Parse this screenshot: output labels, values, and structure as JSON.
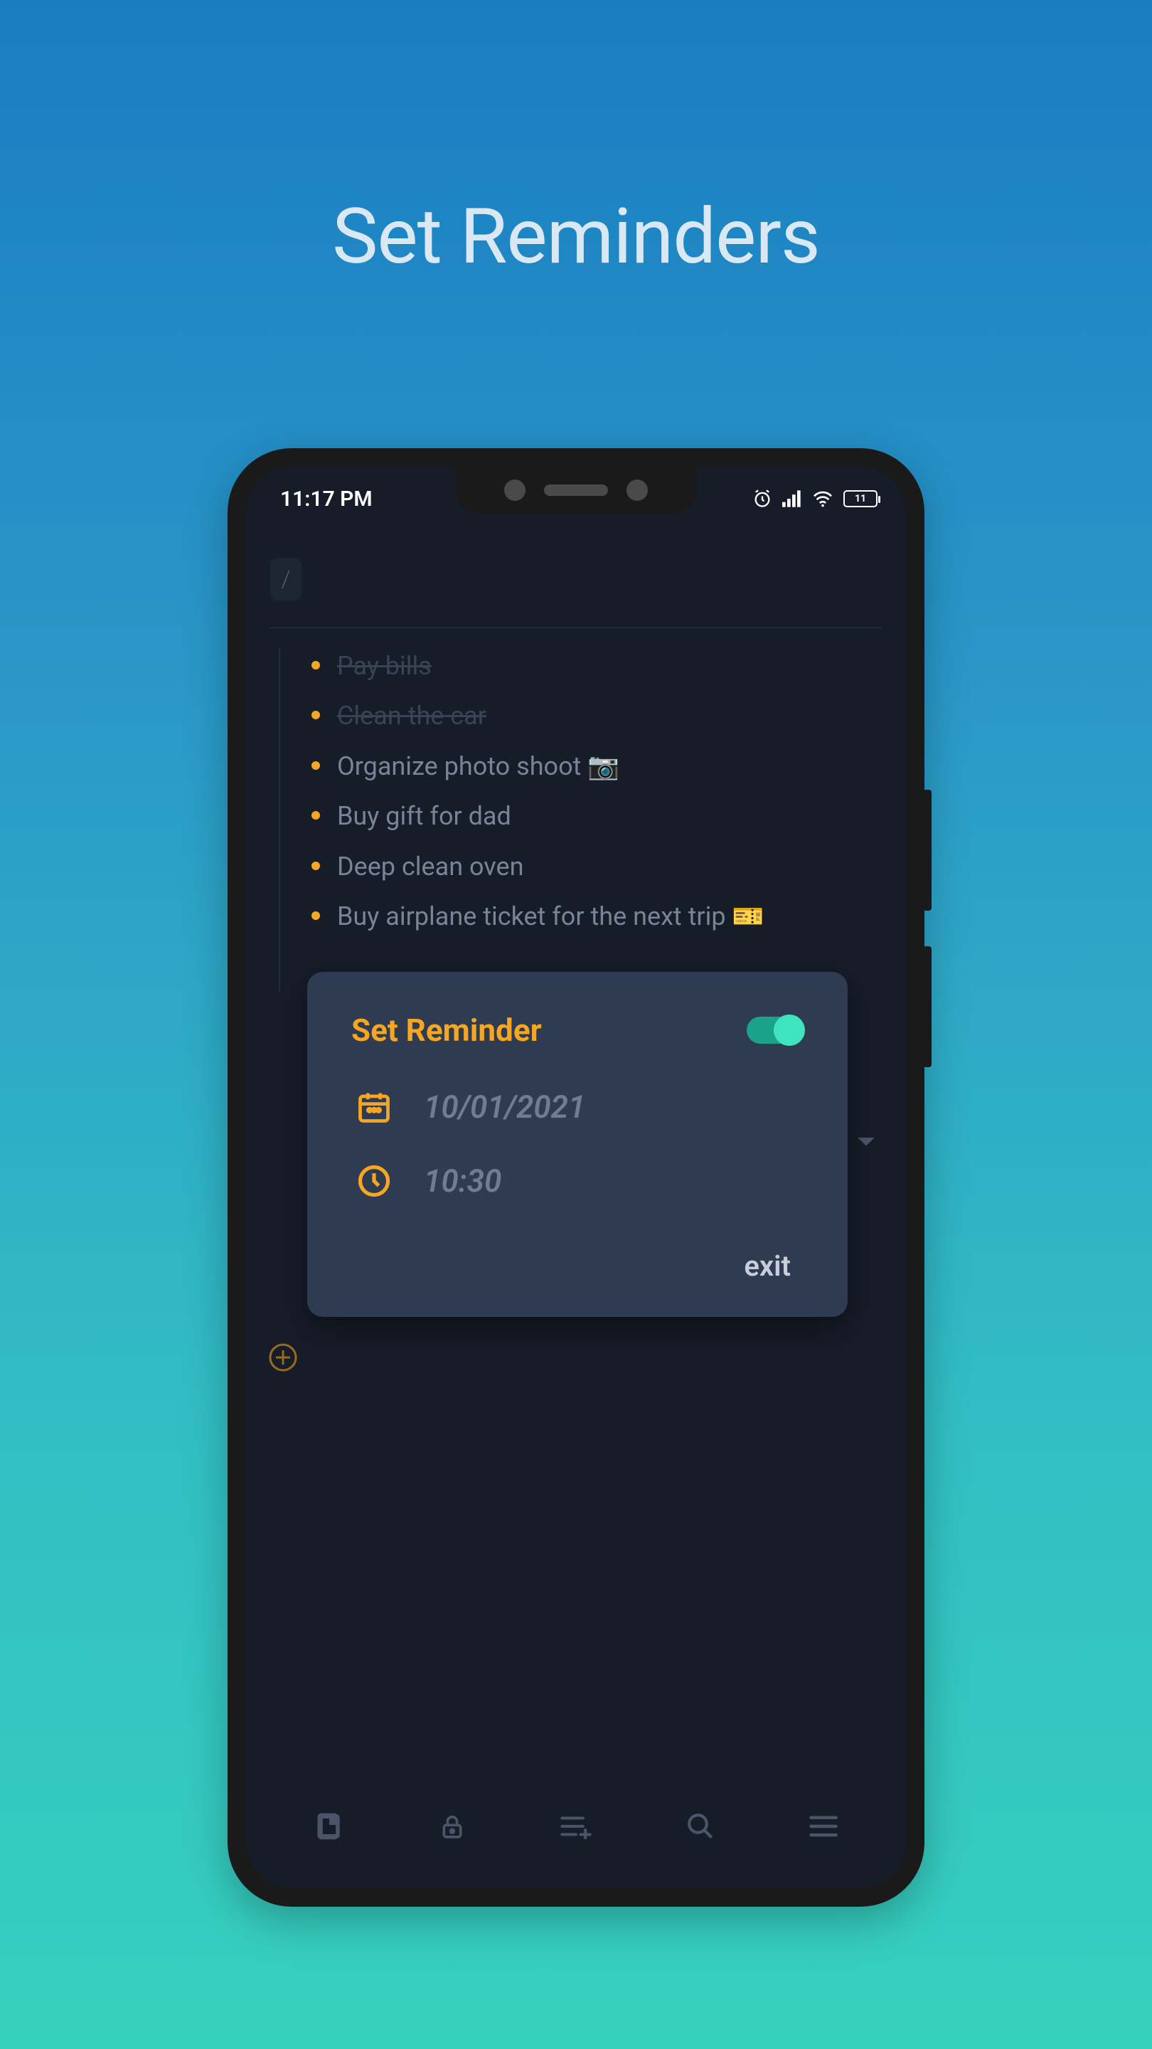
{
  "hero_title": "Set Reminders",
  "status": {
    "time": "11:17 PM",
    "battery_level": "11"
  },
  "breadcrumb": "/",
  "todos": [
    {
      "text": "Pay bills",
      "done": true
    },
    {
      "text": "Clean the car",
      "done": true
    },
    {
      "text": "Organize photo shoot 📷",
      "done": false
    },
    {
      "text": "Buy gift for dad",
      "done": false
    },
    {
      "text": "Deep clean oven",
      "done": false
    },
    {
      "text": "Buy airplane ticket for the next trip 🎫",
      "done": false
    }
  ],
  "dialog": {
    "title": "Set Reminder",
    "enabled": true,
    "date": "10/01/2021",
    "time": "10:30",
    "exit_label": "exit"
  },
  "colors": {
    "accent": "#f5a623",
    "toggle": "#3fe3bd"
  }
}
